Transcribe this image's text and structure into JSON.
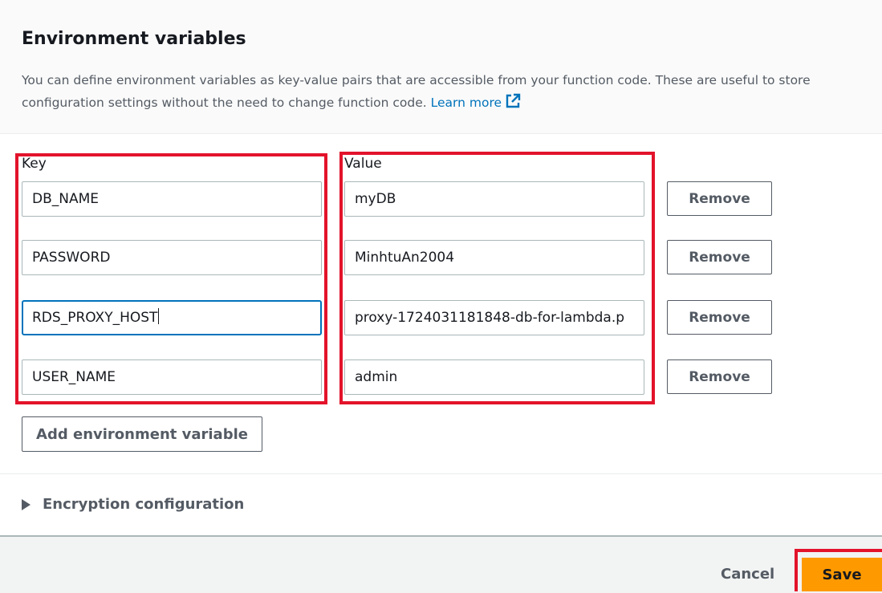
{
  "section": {
    "title": "Environment variables",
    "description": "You can define environment variables as key-value pairs that are accessible from your function code. These are useful to store configuration settings without the need to change function code.",
    "learn_more": "Learn more"
  },
  "columns": {
    "key": "Key",
    "value": "Value"
  },
  "variables": [
    {
      "key": "DB_NAME",
      "value": "myDB",
      "remove": "Remove"
    },
    {
      "key": "PASSWORD",
      "value": "MinhtuAn2004",
      "remove": "Remove"
    },
    {
      "key": "RDS_PROXY_HOST",
      "value": "proxy-1724031181848-db-for-lambda.p",
      "remove": "Remove"
    },
    {
      "key": "USER_NAME",
      "value": "admin",
      "remove": "Remove"
    }
  ],
  "add_button": "Add environment variable",
  "encryption": {
    "label": "Encryption configuration"
  },
  "footer": {
    "cancel": "Cancel",
    "save": "Save"
  },
  "colors": {
    "accent": "#ff9900",
    "link": "#0073bb",
    "highlight": "#e3132b"
  }
}
